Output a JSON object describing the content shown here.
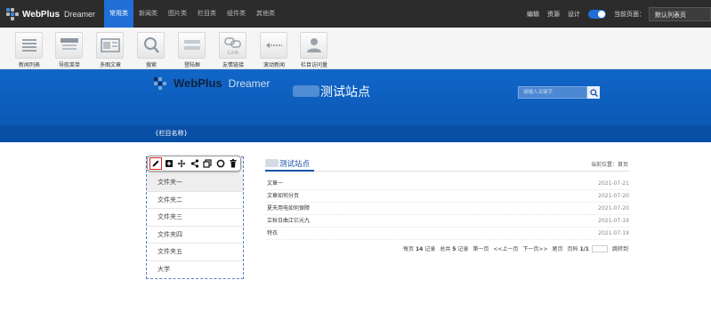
{
  "app": {
    "logo_text": "WebPlus",
    "logo_sub": "Dreamer"
  },
  "topnav": {
    "tabs": [
      "常用类",
      "新闻类",
      "图片类",
      "栏目类",
      "组件类",
      "其他类"
    ],
    "active": 0
  },
  "topright": {
    "links": [
      "编辑",
      "资源",
      "设计"
    ],
    "toggle_on": true,
    "current_page_label": "当前页面：",
    "current_page_value": "默认列表页"
  },
  "toolbar": {
    "items": [
      {
        "label": "新闻列表",
        "icon": "list-icon"
      },
      {
        "label": "导航菜单",
        "icon": "nav-menu-icon"
      },
      {
        "label": "多图文章",
        "icon": "multi-image-icon"
      },
      {
        "label": "搜索",
        "icon": "search-icon"
      },
      {
        "label": "登陆框",
        "icon": "login-box-icon"
      },
      {
        "label": "友情链接",
        "icon": "link-icon"
      },
      {
        "label": "滚动新闻",
        "icon": "scroll-news-icon"
      },
      {
        "label": "栏目访问量",
        "icon": "visitors-icon"
      }
    ]
  },
  "banner": {
    "logo_text": "WebPlus",
    "logo_sub": "Dreamer",
    "site_title": "测试站点",
    "search_placeholder": "请输入关键字"
  },
  "column_bar": {
    "label": "{栏目名称}"
  },
  "edit_tools": [
    {
      "icon": "pencil-icon",
      "selected": true
    },
    {
      "icon": "add-square-icon",
      "selected": false
    },
    {
      "icon": "move-icon",
      "selected": false
    },
    {
      "icon": "share-icon",
      "selected": false
    },
    {
      "icon": "copy-icon",
      "selected": false
    },
    {
      "icon": "circle-icon",
      "selected": false
    },
    {
      "icon": "trash-icon",
      "selected": false
    }
  ],
  "sidebar": {
    "items": [
      "文件夹一",
      "文件夹二",
      "文件夹三",
      "文件夹四",
      "文件夹五",
      "大学"
    ],
    "active": 0
  },
  "main": {
    "title": "测试站点",
    "breadcrumb": "当前位置：首页",
    "articles": [
      {
        "title": "文章一",
        "date": "2021-07-21"
      },
      {
        "title": "文章如何分页",
        "date": "2021-07-20"
      },
      {
        "title": "夏天用电如何保障",
        "date": "2021-07-20"
      },
      {
        "title": "立秋日曲江亿元九",
        "date": "2021-07-19"
      },
      {
        "title": "特衣",
        "date": "2021-07-19"
      }
    ],
    "pager": {
      "per_page_pre": "每页",
      "per_page": "14",
      "per_page_post": "记录",
      "total_pre": "总共",
      "total": "5",
      "total_post": "记录",
      "first": "第一页",
      "prev": "<<上一页",
      "next": "下一页>>",
      "last": "尾页",
      "page_label": "页码",
      "page_value": "1/1",
      "goto": "跳转到"
    }
  },
  "colors": {
    "topbar_bg": "#2c2c2c",
    "accent": "#1f6fd6",
    "banner_bg": "#1166c8",
    "column_bar_bg": "#0a4fa6",
    "title_blue": "#1b52a3",
    "edit_highlight": "#e02020"
  }
}
